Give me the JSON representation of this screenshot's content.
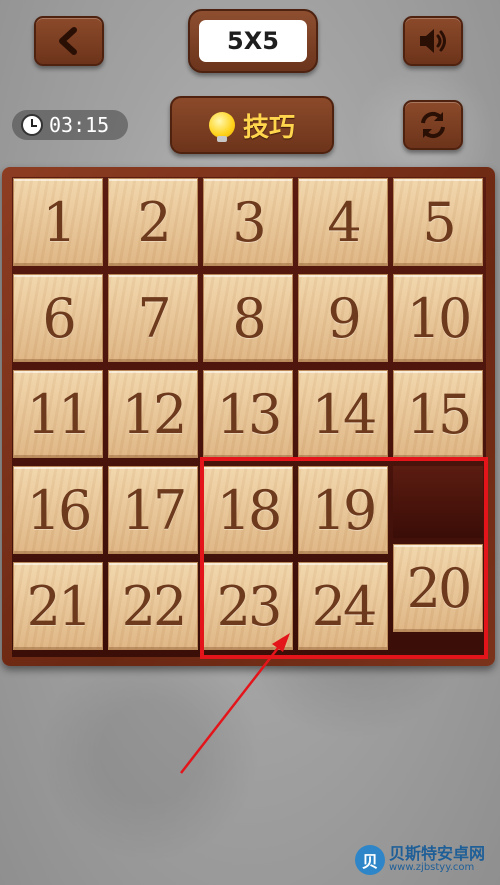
{
  "header": {
    "level_label": "5X5"
  },
  "timer": {
    "time": "03:15"
  },
  "hint": {
    "label": "技巧"
  },
  "board": {
    "size": 5,
    "tiles": [
      {
        "label": "1",
        "row": 0,
        "col": 0
      },
      {
        "label": "2",
        "row": 0,
        "col": 1
      },
      {
        "label": "3",
        "row": 0,
        "col": 2
      },
      {
        "label": "4",
        "row": 0,
        "col": 3
      },
      {
        "label": "5",
        "row": 0,
        "col": 4
      },
      {
        "label": "6",
        "row": 1,
        "col": 0
      },
      {
        "label": "7",
        "row": 1,
        "col": 1
      },
      {
        "label": "8",
        "row": 1,
        "col": 2
      },
      {
        "label": "9",
        "row": 1,
        "col": 3
      },
      {
        "label": "10",
        "row": 1,
        "col": 4
      },
      {
        "label": "11",
        "row": 2,
        "col": 0
      },
      {
        "label": "12",
        "row": 2,
        "col": 1
      },
      {
        "label": "13",
        "row": 2,
        "col": 2
      },
      {
        "label": "14",
        "row": 2,
        "col": 3
      },
      {
        "label": "15",
        "row": 2,
        "col": 4
      },
      {
        "label": "16",
        "row": 3,
        "col": 0
      },
      {
        "label": "17",
        "row": 3,
        "col": 1
      },
      {
        "label": "18",
        "row": 3,
        "col": 2
      },
      {
        "label": "19",
        "row": 3,
        "col": 3
      },
      {
        "label": "21",
        "row": 4,
        "col": 0
      },
      {
        "label": "22",
        "row": 4,
        "col": 1
      },
      {
        "label": "23",
        "row": 4,
        "col": 2
      },
      {
        "label": "24",
        "row": 4,
        "col": 3
      },
      {
        "label": "20",
        "row": 4,
        "col": 4,
        "sliding": true
      }
    ],
    "empty_cell": {
      "row": 3,
      "col": 4
    }
  },
  "colors": {
    "highlight": "#e3151b",
    "tile_text": "#6d3a1e",
    "frame": "#7a3018"
  },
  "icons": {
    "back": "chevron-left-icon",
    "sound": "speaker-icon",
    "refresh": "refresh-icon",
    "hint": "lightbulb-icon",
    "timer": "clock-icon"
  },
  "watermark": {
    "logo_text": "贝",
    "title": "贝斯特安卓网",
    "url": "www.zjbstyy.com"
  }
}
